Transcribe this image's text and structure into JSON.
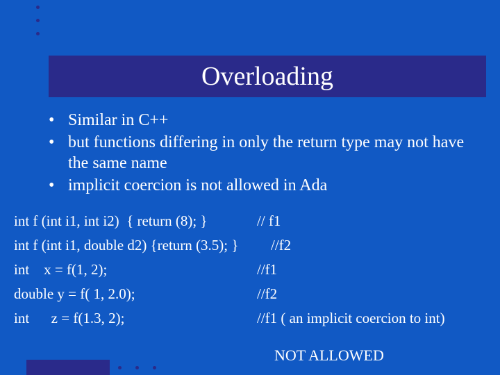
{
  "title": "Overloading",
  "bullets": [
    "Similar in C++",
    "but functions differing in only the return type may not have the same name",
    "implicit coercion is not allowed in Ada"
  ],
  "code_lines": [
    {
      "left": "int f (int i1, int i2)  { return (8); }",
      "right": "// f1"
    },
    {
      "left": "int f (int i1, double d2) {return (3.5); }",
      "right": "//f2"
    },
    {
      "left": "int    x = f(1, 2);",
      "right": "//f1"
    },
    {
      "left": "double y = f( 1, 2.0);",
      "right": "//f2"
    },
    {
      "left": "int      z = f(1.3, 2);",
      "right": "//f1 ( an implicit coercion to int)"
    }
  ],
  "footer": "NOT ALLOWED"
}
